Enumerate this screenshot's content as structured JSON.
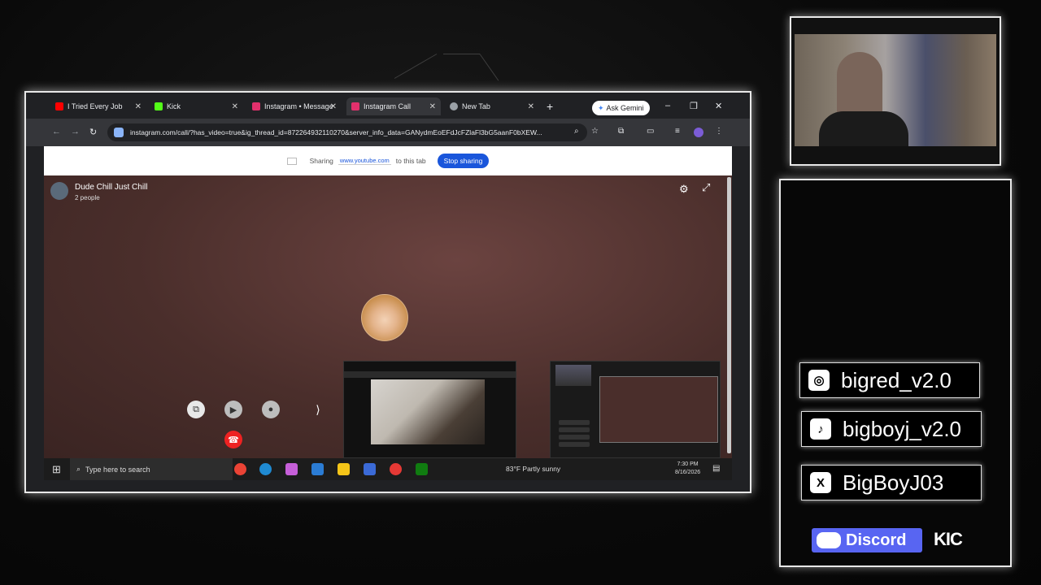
{
  "browser": {
    "tabs": [
      {
        "label": "I Tried Every Job",
        "favicon": "youtube-icon",
        "color": "#ff0000"
      },
      {
        "label": "Kick",
        "favicon": "kick-icon",
        "color": "#53fc18"
      },
      {
        "label": "Instagram • Message",
        "favicon": "instagram-icon",
        "color": "#e1306c"
      },
      {
        "label": "Instagram Call",
        "favicon": "instagram-icon",
        "color": "#e1306c"
      },
      {
        "label": "New Tab",
        "favicon": "chrome-icon",
        "color": "#9aa0a6"
      }
    ],
    "new_tab": "+",
    "ask_gemini": "Ask Gemini",
    "window_controls": {
      "minimize": "–",
      "restore": "❐",
      "close": "✕"
    },
    "url": "instagram.com/call/?has_video=true&ig_thread_id=872264932110270&server_info_data=GANydmEoEFdJcFZlaFl3bG5aanF0bXEW..."
  },
  "share_bar": {
    "sharing": "Sharing",
    "shared_url": "www.youtube.com",
    "to_tab": "to this tab",
    "stop_button": "Stop sharing"
  },
  "call": {
    "group_name": "Dude Chill Just Chill",
    "people_count": "2 people"
  },
  "taskbar": {
    "search_placeholder": "Type here to search",
    "weather": "83°F  Partly sunny",
    "time": "7:30 PM",
    "date": "8/16/2026"
  },
  "socials": {
    "instagram": "bigred_v2.0",
    "tiktok": "bigboyj_v2.0",
    "x": "BigBoyJ03",
    "discord": "Discord",
    "kick": "KIC"
  }
}
